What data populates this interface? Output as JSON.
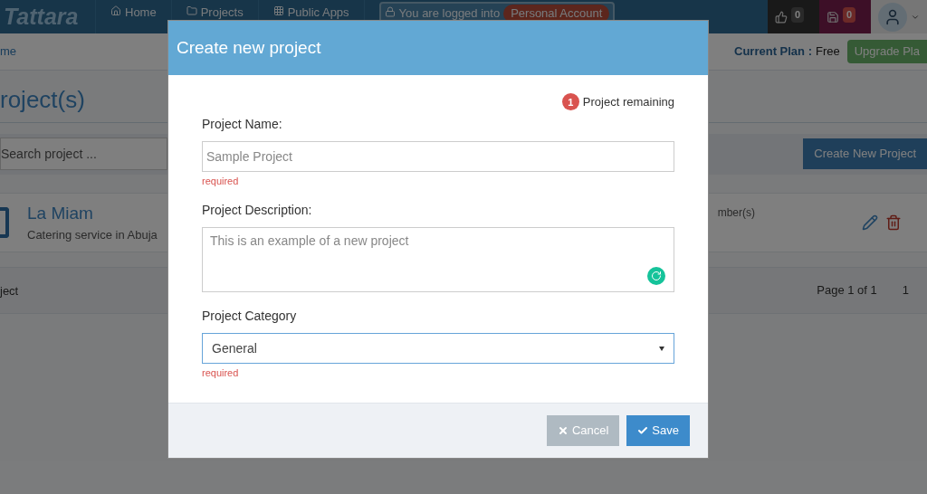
{
  "navbar": {
    "logo": "Tattara",
    "items": [
      {
        "label": "Home"
      },
      {
        "label": "Projects"
      },
      {
        "label": "Public Apps"
      }
    ],
    "login_notice": {
      "text": "You are logged into",
      "account": "Personal Account"
    },
    "counters": [
      {
        "count": "0"
      },
      {
        "count": "0"
      }
    ]
  },
  "breadcrumb": "me",
  "plan": {
    "label": "Current Plan :",
    "value": "Free",
    "upgrade": "Upgrade Pla"
  },
  "page_title": "roject(s)",
  "search": {
    "placeholder": "Search project ..."
  },
  "create_button": "Create New Project",
  "projects": [
    {
      "name": "La Miam",
      "description": "Catering service in Abuja",
      "members": "mber(s)"
    }
  ],
  "list_footer": {
    "left": "ject",
    "page_info": "Page 1 of 1",
    "page_number": "1"
  },
  "modal": {
    "title": "Create new project",
    "remaining_count": "1",
    "remaining_label": "Project remaining",
    "fields": [
      {
        "kind": "input",
        "label": "Project Name:",
        "placeholder": "Sample Project",
        "hint": "required",
        "focused": false
      },
      {
        "kind": "textarea",
        "label": "Project Description:",
        "placeholder": "This is an example of a new project",
        "focused": false
      },
      {
        "kind": "select",
        "label": "Project Category",
        "value": "General",
        "hint": "required",
        "focused": true
      }
    ],
    "buttons": [
      {
        "kind": "cancel",
        "label": "Cancel"
      },
      {
        "kind": "save",
        "label": "Save"
      }
    ]
  }
}
